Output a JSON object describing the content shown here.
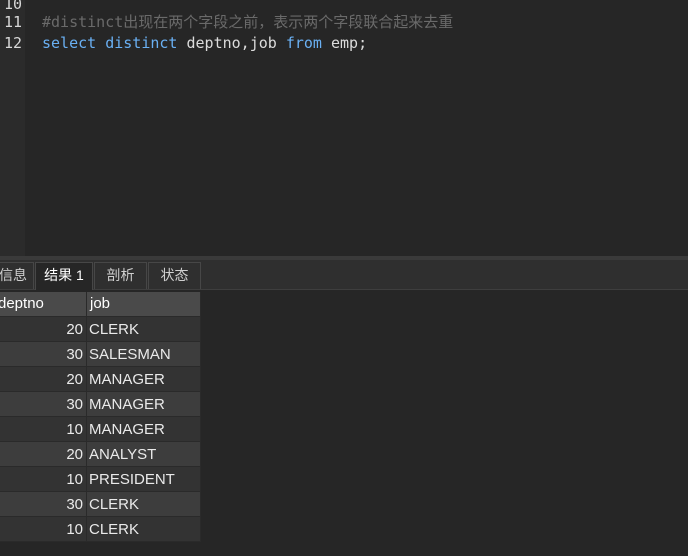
{
  "editor": {
    "lines": [
      {
        "number": "10",
        "text": ""
      },
      {
        "number": "11",
        "text": "#distinct出现在两个字段之前，表示两个字段联合起来去重"
      },
      {
        "number": "12",
        "tokens": [
          "select",
          "distinct",
          "deptno,job",
          "from",
          "emp;"
        ]
      }
    ]
  },
  "tabs": [
    {
      "label": "信息",
      "active": false
    },
    {
      "label": "结果 1",
      "active": true
    },
    {
      "label": "剖析",
      "active": false
    },
    {
      "label": "状态",
      "active": false
    }
  ],
  "grid": {
    "columns": [
      "deptno",
      "job"
    ],
    "rows": [
      [
        "20",
        "CLERK"
      ],
      [
        "30",
        "SALESMAN"
      ],
      [
        "20",
        "MANAGER"
      ],
      [
        "30",
        "MANAGER"
      ],
      [
        "10",
        "MANAGER"
      ],
      [
        "20",
        "ANALYST"
      ],
      [
        "10",
        "PRESIDENT"
      ],
      [
        "30",
        "CLERK"
      ],
      [
        "10",
        "CLERK"
      ]
    ]
  },
  "colors": {
    "keyword": "#6ab0f3",
    "comment": "#6a6a6a",
    "background": "#262626"
  }
}
